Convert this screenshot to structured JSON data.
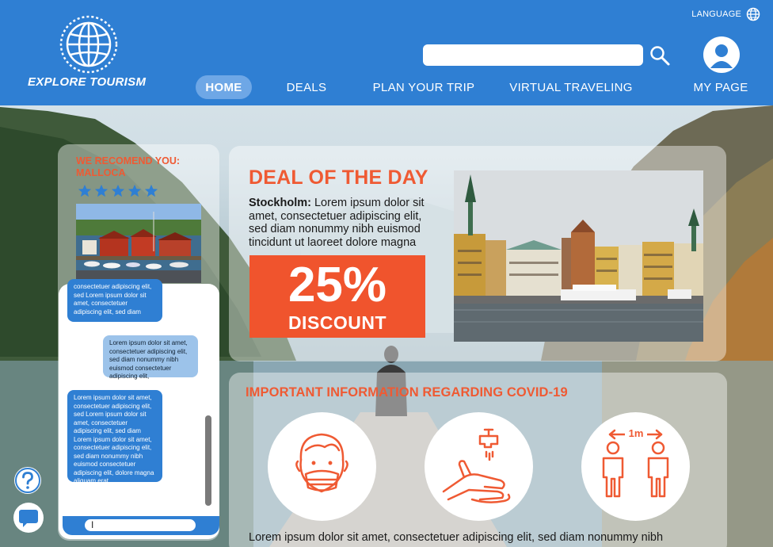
{
  "header": {
    "brand": "EXPLORE TOURISM",
    "language_label": "LANGUAGE",
    "search": {
      "value": "",
      "placeholder": ""
    },
    "nav": [
      {
        "label": "HOME",
        "active": true
      },
      {
        "label": "DEALS",
        "active": false
      },
      {
        "label": "PLAN YOUR TRIP",
        "active": false
      },
      {
        "label": "VIRTUAL TRAVELING",
        "active": false
      },
      {
        "label": "MY PAGE",
        "active": false
      }
    ]
  },
  "recommend": {
    "title": "WE RECOMEND YOU:",
    "place": "MALLOCA",
    "rating": 5
  },
  "chat": {
    "messages": [
      {
        "from": "agent",
        "text": "consectetuer adipiscing elit, sed Lorem ipsum dolor sit amet, consectetuer adipiscing elit, sed diam"
      },
      {
        "from": "user",
        "text": "Lorem ipsum dolor sit amet, consectetuer adipiscing elit, sed diam nonummy nibh euismod consectetuer adipiscing elit,"
      },
      {
        "from": "agent",
        "text": "Lorem ipsum dolor sit amet, consectetuer adipiscing elit, sed Lorem ipsum dolor sit amet, consectetuer adipiscing elit, sed diam Lorem ipsum dolor sit amet, consectetuer adipiscing elit, sed diam nonummy nibh euismod consectetuer adipiscing elit, dolore magna aliquam erat"
      }
    ],
    "input_value": ""
  },
  "deal": {
    "title": "DEAL OF THE DAY",
    "city": "Stockholm:",
    "text": " Lorem ipsum dolor sit amet, consectetuer adipiscing elit, sed diam nonummy nibh euismod tincidunt ut laoreet dolore magna",
    "percent": "25%",
    "discount_label": "DISCOUNT"
  },
  "covid": {
    "title": "IMPORTANT INFORMATION REGARDING COVID-19",
    "icons": [
      "face-mask-icon",
      "hand-washing-icon",
      "social-distance-icon"
    ],
    "distance_label": "1m",
    "text": "Lorem ipsum dolor sit amet, consectetuer adipiscing elit, sed diam nonummy nibh"
  },
  "colors": {
    "header_blue": "#2f7fd3",
    "accent_orange": "#ef5a33",
    "star_blue": "#2f7fd3"
  }
}
